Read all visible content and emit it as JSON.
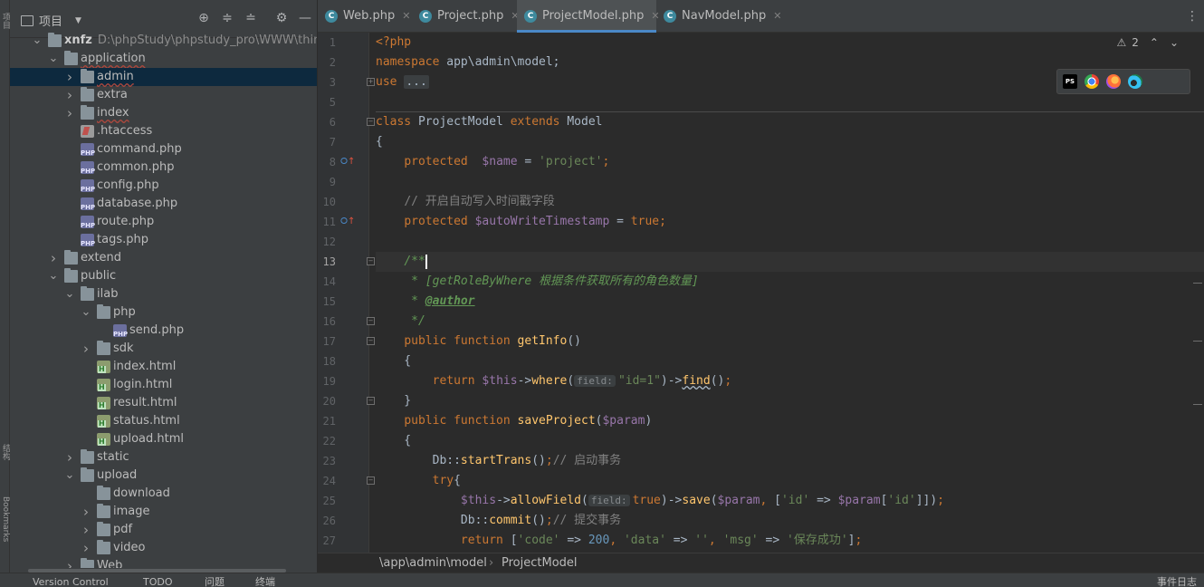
{
  "left_strip": {
    "top_label": "项目",
    "mid_label": "结构",
    "bottom_label": "Bookmarks"
  },
  "project_panel": {
    "title": "项目",
    "icons": [
      "crosshair-icon",
      "expand-all-icon",
      "collapse-all-icon",
      "gear-icon",
      "minimize-icon"
    ]
  },
  "tree": [
    {
      "label": "xnfz",
      "path": "D:\\phpStudy\\phpstudy_pro\\WWW\\thinkphp\\x",
      "type": "folder",
      "indent": 0,
      "expanded": true,
      "root": true
    },
    {
      "label": "application",
      "type": "folder",
      "indent": 1,
      "expanded": true
    },
    {
      "label": "admin",
      "type": "folder",
      "indent": 2,
      "expanded": false,
      "selected": true
    },
    {
      "label": "extra",
      "type": "folder",
      "indent": 2,
      "expanded": false
    },
    {
      "label": "index",
      "type": "folder",
      "indent": 2,
      "expanded": false
    },
    {
      "label": ".htaccess",
      "type": "htaccess",
      "indent": 2
    },
    {
      "label": "command.php",
      "type": "php",
      "indent": 2
    },
    {
      "label": "common.php",
      "type": "php",
      "indent": 2
    },
    {
      "label": "config.php",
      "type": "php",
      "indent": 2
    },
    {
      "label": "database.php",
      "type": "php",
      "indent": 2
    },
    {
      "label": "route.php",
      "type": "php",
      "indent": 2
    },
    {
      "label": "tags.php",
      "type": "php",
      "indent": 2
    },
    {
      "label": "extend",
      "type": "folder",
      "indent": 1,
      "expanded": false
    },
    {
      "label": "public",
      "type": "folder",
      "indent": 1,
      "expanded": true
    },
    {
      "label": "ilab",
      "type": "folder",
      "indent": 2,
      "expanded": true
    },
    {
      "label": "php",
      "type": "folder",
      "indent": 3,
      "expanded": true
    },
    {
      "label": "send.php",
      "type": "php",
      "indent": 4
    },
    {
      "label": "sdk",
      "type": "folder",
      "indent": 3,
      "expanded": false
    },
    {
      "label": "index.html",
      "type": "html",
      "indent": 3
    },
    {
      "label": "login.html",
      "type": "html",
      "indent": 3
    },
    {
      "label": "result.html",
      "type": "html",
      "indent": 3
    },
    {
      "label": "status.html",
      "type": "html",
      "indent": 3
    },
    {
      "label": "upload.html",
      "type": "html",
      "indent": 3
    },
    {
      "label": "static",
      "type": "folder",
      "indent": 2,
      "expanded": false
    },
    {
      "label": "upload",
      "type": "folder",
      "indent": 2,
      "expanded": true
    },
    {
      "label": "download",
      "type": "folder",
      "indent": 3,
      "leaf": true
    },
    {
      "label": "image",
      "type": "folder",
      "indent": 3,
      "expanded": false
    },
    {
      "label": "pdf",
      "type": "folder",
      "indent": 3,
      "expanded": false
    },
    {
      "label": "video",
      "type": "folder",
      "indent": 3,
      "expanded": false
    },
    {
      "label": "Web",
      "type": "folder",
      "indent": 2,
      "expanded": false
    }
  ],
  "tabs": [
    {
      "label": "Web.php",
      "active": false
    },
    {
      "label": "Project.php",
      "active": false
    },
    {
      "label": "ProjectModel.php",
      "active": true
    },
    {
      "label": "NavModel.php",
      "active": false
    }
  ],
  "inspection": {
    "warnings": "2"
  },
  "code_lines": [
    {
      "n": "1",
      "html": "<span class=\"k\">&lt;?php</span>"
    },
    {
      "n": "2",
      "html": "<span class=\"k\">namespace</span> app\\admin\\model;"
    },
    {
      "n": "3",
      "html": "<span class=\"k\">use</span> <span class=\"fold-dots\">...</span>"
    },
    {
      "n": "5",
      "html": ""
    },
    {
      "n": "6",
      "html": "<span class=\"k\">class</span> ProjectModel <span class=\"k\">extends</span> Model"
    },
    {
      "n": "7",
      "html": "{"
    },
    {
      "n": "8",
      "html": "    <span class=\"k\">protected</span>  <span class=\"v\">$name</span> = <span class=\"s\">'project'</span><span class=\"k\">;</span>"
    },
    {
      "n": "9",
      "html": ""
    },
    {
      "n": "10",
      "html": "    <span class=\"cm\">// 开启自动写入时间戳字段</span>"
    },
    {
      "n": "11",
      "html": "    <span class=\"k\">protected</span> <span class=\"v\">$autoWriteTimestamp</span> = <span class=\"k\">true;</span>"
    },
    {
      "n": "12",
      "html": ""
    },
    {
      "n": "13",
      "html": "    <span class=\"dc\">/**</span><span class=\"caret\"></span>"
    },
    {
      "n": "14",
      "html": "     <span class=\"dc\">* [getRoleByWhere 根据条件获取所有的角色数量]</span>"
    },
    {
      "n": "15",
      "html": "     <span class=\"dc\">* </span><span class=\"tag\">@author</span>"
    },
    {
      "n": "16",
      "html": "     <span class=\"dc\">*/</span>"
    },
    {
      "n": "17",
      "html": "    <span class=\"k\">public function</span> <span class=\"f\">getInfo</span>()"
    },
    {
      "n": "18",
      "html": "    {"
    },
    {
      "n": "19",
      "html": "        <span class=\"k\">return</span> <span class=\"v\">$this</span>-><span class=\"f\">where</span>(<span class=\"hint\">field:</span><span class=\"s\">\"id=1\"</span>)-><span class=\"f\" style=\"text-decoration:underline wavy #a9b7c6\">find</span>()<span class=\"k\">;</span>"
    },
    {
      "n": "20",
      "html": "    }"
    },
    {
      "n": "21",
      "html": "    <span class=\"k\">public function</span> <span class=\"f\">saveProject</span>(<span class=\"v\">$param</span>)"
    },
    {
      "n": "22",
      "html": "    {"
    },
    {
      "n": "23",
      "html": "        Db::<span class=\"f\">startTrans</span>()<span class=\"k\">;</span><span class=\"cm\">// 启动事务</span>"
    },
    {
      "n": "24",
      "html": "        <span class=\"k\">try</span>{"
    },
    {
      "n": "25",
      "html": "            <span class=\"v\">$this</span>-><span class=\"f\">allowField</span>(<span class=\"hint\">field:</span><span class=\"k\">true</span>)-><span class=\"f\">save</span>(<span class=\"v\">$param</span><span class=\"k\">,</span> [<span class=\"s\">'id'</span> => <span class=\"v\">$param</span>[<span class=\"s\">'id'</span>]])<span class=\"k\">;</span>"
    },
    {
      "n": "26",
      "html": "            Db::<span class=\"f\">commit</span>()<span class=\"k\">;</span><span class=\"cm\">// 提交事务</span>"
    },
    {
      "n": "27",
      "html": "            <span class=\"k\">return</span> [<span class=\"s\">'code'</span> => <span style=\"color:#6897bb\">200</span><span class=\"k\">,</span> <span class=\"s\">'data'</span> => <span class=\"s\">''</span><span class=\"k\">,</span> <span class=\"s\">'msg'</span> => <span class=\"s\">'保存成功'</span>]<span class=\"k\">;</span>"
    }
  ],
  "current_line": "13",
  "breadcrumb": {
    "path": "\\app\\admin\\model",
    "cls": "ProjectModel"
  },
  "status": {
    "version_control": "Version Control",
    "todo": "TODO",
    "problems": "问题",
    "terminal": "终端",
    "event_log": "事件日志"
  }
}
